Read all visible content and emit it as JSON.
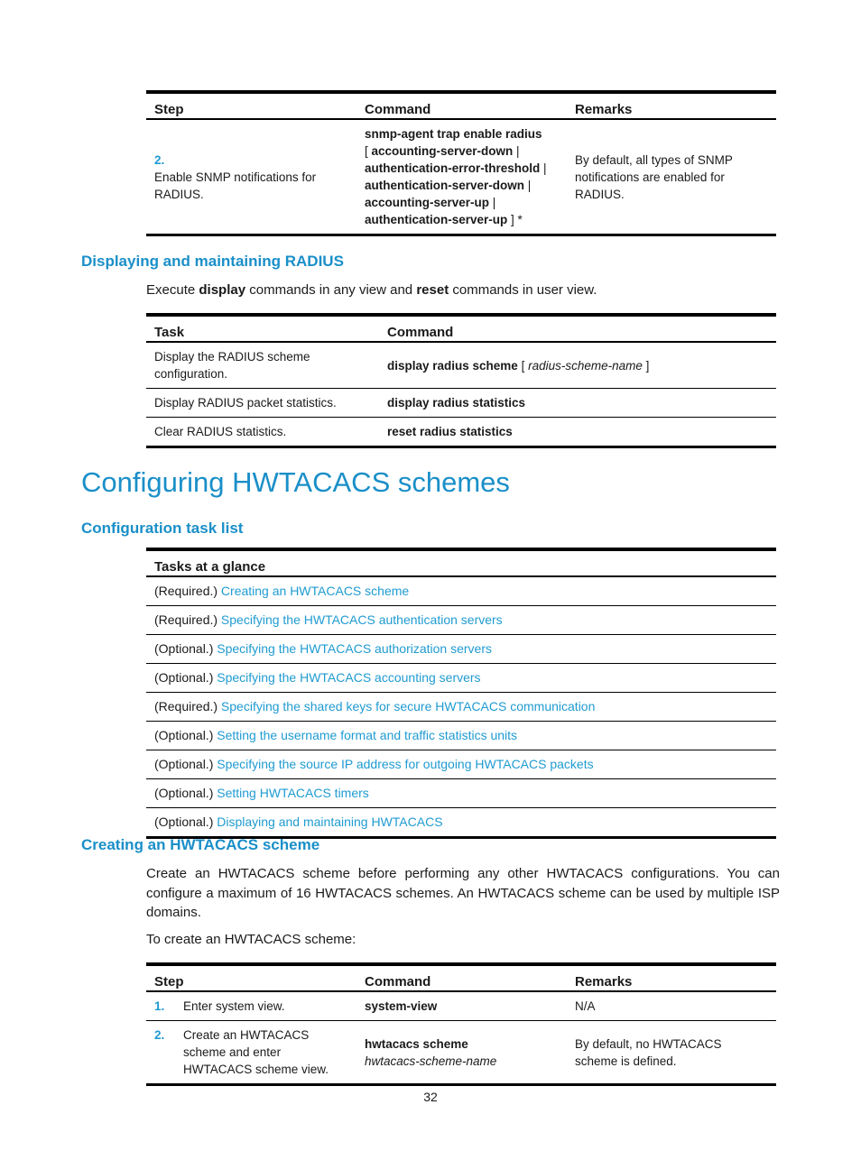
{
  "table1": {
    "headers": [
      "Step",
      "Command",
      "Remarks"
    ],
    "rows": [
      {
        "num": "2.",
        "step": "Enable SNMP notifications for RADIUS.",
        "command_lines": [
          {
            "bold": "snmp-agent trap enable radius",
            "pre": "",
            "post": ""
          },
          {
            "pre": "[ ",
            "bold": "accounting-server-down",
            "post": " |"
          },
          {
            "pre": "",
            "bold": "authentication-error-threshold",
            "post": " |"
          },
          {
            "pre": "",
            "bold": "authentication-server-down",
            "post": " |"
          },
          {
            "pre": "",
            "bold": "accounting-server-up",
            "post": " |"
          },
          {
            "pre": "",
            "bold": "authentication-server-up",
            "post": " ] *"
          }
        ],
        "remarks": "By default, all types of SNMP notifications are enabled for RADIUS."
      }
    ]
  },
  "section_radius": {
    "heading": "Displaying and maintaining RADIUS",
    "intro": {
      "t1": "Execute ",
      "b1": "display",
      "t2": " commands in any view and ",
      "b2": "reset",
      "t3": " commands in user view."
    }
  },
  "table2": {
    "headers": [
      "Task",
      "Command"
    ],
    "rows": [
      {
        "task": "Display the RADIUS scheme configuration.",
        "cmd_bold": "display radius scheme",
        "cmd_pre": " [ ",
        "cmd_italic": "radius-scheme-name",
        "cmd_post": " ]"
      },
      {
        "task": "Display RADIUS packet statistics.",
        "cmd_bold": "display radius statistics",
        "cmd_pre": "",
        "cmd_italic": "",
        "cmd_post": ""
      },
      {
        "task": "Clear RADIUS statistics.",
        "cmd_bold": "reset radius statistics",
        "cmd_pre": "",
        "cmd_italic": "",
        "cmd_post": ""
      }
    ]
  },
  "chapter_title": "Configuring HWTACACS schemes",
  "section_tasklist": {
    "heading": "Configuration task list",
    "table_header": "Tasks at a glance",
    "rows": [
      {
        "req": "(Required.) ",
        "link": "Creating an HWTACACS scheme"
      },
      {
        "req": "(Required.) ",
        "link": "Specifying the HWTACACS authentication servers"
      },
      {
        "req": "(Optional.) ",
        "link": "Specifying the HWTACACS authorization servers"
      },
      {
        "req": "(Optional.) ",
        "link": "Specifying the HWTACACS accounting servers"
      },
      {
        "req": "(Required.) ",
        "link": "Specifying the shared keys for secure HWTACACS communication"
      },
      {
        "req": "(Optional.) ",
        "link": "Setting the username format and traffic statistics units"
      },
      {
        "req": "(Optional.) ",
        "link": "Specifying the source IP address for outgoing HWTACACS packets"
      },
      {
        "req": "(Optional.) ",
        "link": "Setting HWTACACS timers"
      },
      {
        "req": "(Optional.) ",
        "link": "Displaying and maintaining HWTACACS"
      }
    ]
  },
  "section_create": {
    "heading": "Creating an HWTACACS scheme",
    "para1": "Create an HWTACACS scheme before performing any other HWTACACS configurations. You can configure a maximum of 16 HWTACACS schemes. An HWTACACS scheme can be used by multiple ISP domains.",
    "para2": "To create an HWTACACS scheme:"
  },
  "table3": {
    "headers": [
      "Step",
      "Command",
      "Remarks"
    ],
    "rows": [
      {
        "num": "1.",
        "step": "Enter system view.",
        "cmd_bold": "system-view",
        "cmd_italic": "",
        "remarks": "N/A"
      },
      {
        "num": "2.",
        "step": "Create an HWTACACS scheme and enter HWTACACS scheme view.",
        "cmd_bold": "hwtacacs scheme",
        "cmd_italic": "hwtacacs-scheme-name",
        "remarks": "By default, no HWTACACS scheme is defined."
      }
    ]
  },
  "page_number": "32",
  "colors": {
    "heading": "#1a8fc8",
    "link": "#1f9bd1",
    "text": "#1a1a1a"
  }
}
